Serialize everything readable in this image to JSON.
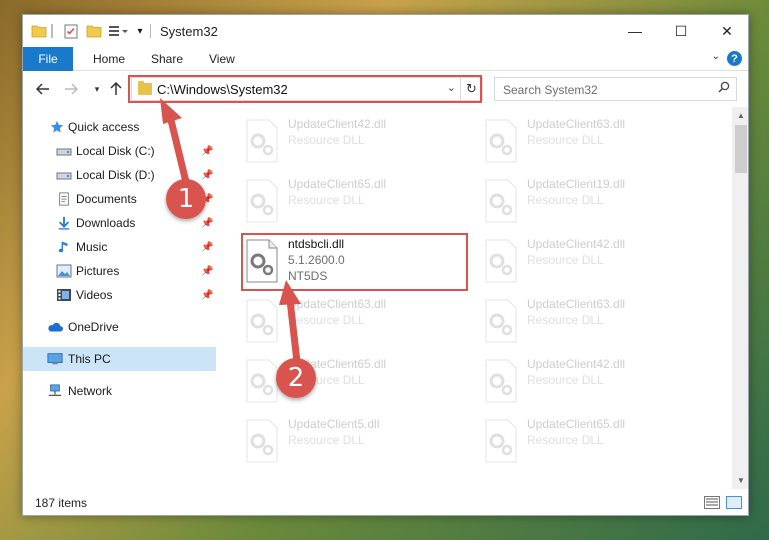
{
  "window": {
    "title": "System32",
    "controls": {
      "minimize": "—",
      "maximize": "☐",
      "close": "✕"
    }
  },
  "ribbon": {
    "tabs": [
      "File",
      "Home",
      "Share",
      "View"
    ],
    "help": "?"
  },
  "address": {
    "path": "C:\\Windows\\System32",
    "search_placeholder": "Search System32"
  },
  "navigation": {
    "items": [
      {
        "label": "Quick access",
        "icon": "star-icon",
        "pinned": false
      },
      {
        "label": "Local Disk (C:)",
        "icon": "drive-icon",
        "pinned": true
      },
      {
        "label": "Local Disk (D:)",
        "icon": "drive-icon",
        "pinned": true
      },
      {
        "label": "Documents",
        "icon": "documents-icon",
        "pinned": true
      },
      {
        "label": "Downloads",
        "icon": "download-icon",
        "pinned": true
      },
      {
        "label": "Music",
        "icon": "music-icon",
        "pinned": true
      },
      {
        "label": "Pictures",
        "icon": "pictures-icon",
        "pinned": true
      },
      {
        "label": "Videos",
        "icon": "videos-icon",
        "pinned": true
      },
      {
        "label": "OneDrive",
        "icon": "cloud-icon",
        "pinned": false
      },
      {
        "label": "This PC",
        "icon": "computer-icon",
        "pinned": false,
        "selected": true
      },
      {
        "label": "Network",
        "icon": "network-icon",
        "pinned": false
      }
    ]
  },
  "files": [
    {
      "name": "UpdateClient42.dll",
      "desc": "Resource DLL",
      "faded": true
    },
    {
      "name": "UpdateClient63.dll",
      "desc": "Resource DLL",
      "faded": true
    },
    {
      "name": "UpdateClient65.dll",
      "desc": "Resource DLL",
      "faded": true
    },
    {
      "name": "UpdateClient19.dll",
      "desc": "Resource DLL",
      "faded": true
    },
    {
      "name": "ntdsbcli.dll",
      "version": "5.1.2600.0",
      "desc": "NT5DS",
      "faded": false
    },
    {
      "name": "UpdateClient42.dll",
      "desc": "Resource DLL",
      "faded": true
    },
    {
      "name": "UpdateClient63.dll",
      "desc": "Resource DLL",
      "faded": true
    },
    {
      "name": "UpdateClient63.dll",
      "desc": "Resource DLL",
      "faded": true
    },
    {
      "name": "UpdateClient65.dll",
      "desc": "Resource DLL",
      "faded": true
    },
    {
      "name": "UpdateClient42.dll",
      "desc": "Resource DLL",
      "faded": true
    },
    {
      "name": "UpdateClient5.dll",
      "desc": "Resource DLL",
      "faded": true
    },
    {
      "name": "UpdateClient65.dll",
      "desc": "Resource DLL",
      "faded": true
    }
  ],
  "status": {
    "item_count": "187 items"
  },
  "annotations": {
    "callout1": "1",
    "callout2": "2",
    "color": "#d9534f"
  }
}
